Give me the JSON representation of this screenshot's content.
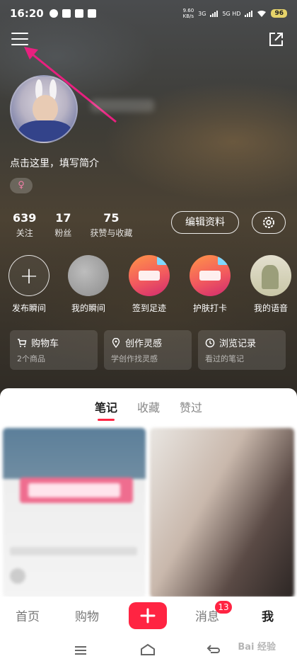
{
  "status_bar": {
    "time": "16:20",
    "net_speed": "9.60",
    "net_unit": "KB/s",
    "signal1": "3G",
    "signal2": "5G HD",
    "battery": "96"
  },
  "profile": {
    "bio": "点击这里，填写简介",
    "gender_symbol": "♀",
    "stats": [
      {
        "num": "639",
        "label": "关注"
      },
      {
        "num": "17",
        "label": "粉丝"
      },
      {
        "num": "75",
        "label": "获赞与收藏"
      }
    ],
    "edit_label": "编辑资料"
  },
  "moments": [
    {
      "label": "发布瞬间",
      "icon": "+"
    },
    {
      "label": "我的瞬间"
    },
    {
      "label": "签到足迹"
    },
    {
      "label": "护肤打卡"
    },
    {
      "label": "我的语音"
    }
  ],
  "quick_cards": [
    {
      "title": "购物车",
      "sub": "2个商品",
      "icon": "cart-icon"
    },
    {
      "title": "创作灵感",
      "sub": "学创作找灵感",
      "icon": "location-pin-icon"
    },
    {
      "title": "浏览记录",
      "sub": "看过的笔记",
      "icon": "clock-icon"
    }
  ],
  "content_tabs": [
    "笔记",
    "收藏",
    "赞过"
  ],
  "bottom_nav": {
    "home": "首页",
    "shop": "购物",
    "add": "+",
    "messages": "消息",
    "messages_badge": "13",
    "me": "我"
  },
  "watermark": "Bai 经验",
  "colors": {
    "accent": "#ff2442",
    "gender": "#f27fa8"
  }
}
